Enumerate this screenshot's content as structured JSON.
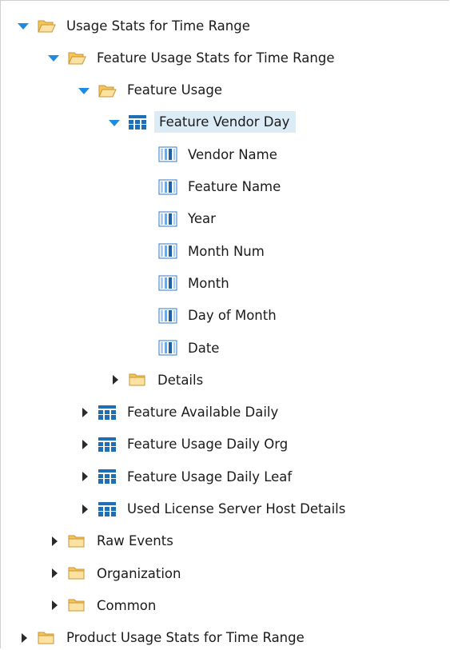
{
  "tree": [
    {
      "key": "usage-stats",
      "label": "Usage Stats for Time Range",
      "icon": "folder-open-icon",
      "toggle": "expanded"
    },
    {
      "key": "feature-usage-stats",
      "label": "Feature Usage Stats for Time Range",
      "icon": "folder-open-icon",
      "toggle": "expanded"
    },
    {
      "key": "feature-usage",
      "label": "Feature Usage",
      "icon": "folder-open-icon",
      "toggle": "expanded"
    },
    {
      "key": "feature-vendor-day",
      "label": "Feature Vendor Day",
      "icon": "table-icon",
      "toggle": "expanded",
      "selected": true
    },
    {
      "key": "vendor-name",
      "label": "Vendor Name",
      "icon": "column-icon",
      "toggle": "none"
    },
    {
      "key": "feature-name",
      "label": "Feature Name",
      "icon": "column-icon",
      "toggle": "none"
    },
    {
      "key": "year",
      "label": "Year",
      "icon": "column-icon",
      "toggle": "none"
    },
    {
      "key": "month-num",
      "label": "Month Num",
      "icon": "column-icon",
      "toggle": "none"
    },
    {
      "key": "month",
      "label": "Month",
      "icon": "column-icon",
      "toggle": "none"
    },
    {
      "key": "day-of-month",
      "label": "Day of Month",
      "icon": "column-icon",
      "toggle": "none"
    },
    {
      "key": "date",
      "label": "Date",
      "icon": "column-icon",
      "toggle": "none"
    },
    {
      "key": "details",
      "label": "Details",
      "icon": "folder-closed-icon",
      "toggle": "collapsed"
    },
    {
      "key": "feature-available-daily",
      "label": "Feature Available Daily",
      "icon": "table-icon",
      "toggle": "collapsed"
    },
    {
      "key": "feature-usage-daily-org",
      "label": "Feature Usage Daily Org",
      "icon": "table-icon",
      "toggle": "collapsed"
    },
    {
      "key": "feature-usage-daily-leaf",
      "label": "Feature Usage Daily Leaf",
      "icon": "table-icon",
      "toggle": "collapsed"
    },
    {
      "key": "used-license-server-host-details",
      "label": "Used License Server Host Details",
      "icon": "table-icon",
      "toggle": "collapsed"
    },
    {
      "key": "raw-events",
      "label": "Raw Events",
      "icon": "folder-closed-icon",
      "toggle": "collapsed"
    },
    {
      "key": "organization",
      "label": "Organization",
      "icon": "folder-closed-icon",
      "toggle": "collapsed"
    },
    {
      "key": "common",
      "label": "Common",
      "icon": "folder-closed-icon",
      "toggle": "collapsed"
    },
    {
      "key": "product-usage-stats",
      "label": "Product Usage Stats for Time Range",
      "icon": "folder-closed-icon",
      "toggle": "collapsed"
    }
  ],
  "colors": {
    "toggle_open": "#1d8be0",
    "folder": "#f5c45e",
    "table_icon": "#1f6fb8",
    "selection": "#dcecf7"
  }
}
